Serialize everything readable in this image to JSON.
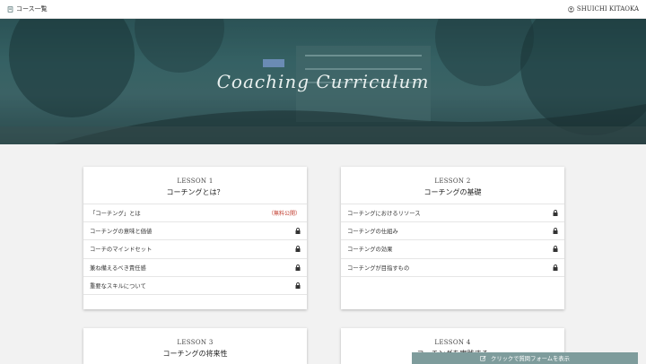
{
  "topbar": {
    "course_list_label": "コース一覧",
    "user_name": "SHUICHI KITAOKA"
  },
  "hero": {
    "title": "Coaching Curriculum"
  },
  "lessons": [
    {
      "number": "LESSON 1",
      "title": "コーチングとは？",
      "items": [
        {
          "label": "「コーチング」とは",
          "badge": "（無料公開）"
        },
        {
          "label": "コーチングの意味と価値"
        },
        {
          "label": "コーチのマインドセット"
        },
        {
          "label": "兼ね備えるべき責任感"
        },
        {
          "label": "重要なスキルについて"
        }
      ]
    },
    {
      "number": "LESSON 2",
      "title": "コーチングの基礎",
      "items": [
        {
          "label": "コーチングにおけるリソース"
        },
        {
          "label": "コーチングの仕組み"
        },
        {
          "label": "コーチングの効果"
        },
        {
          "label": "コーチングが目指すもの"
        }
      ]
    },
    {
      "number": "LESSON 3",
      "title": "コーチングの将来性"
    },
    {
      "number": "LESSON 4",
      "title": "コーチングを実践する"
    }
  ],
  "question_bar": {
    "label": "クリックで質問フォームを表示"
  }
}
